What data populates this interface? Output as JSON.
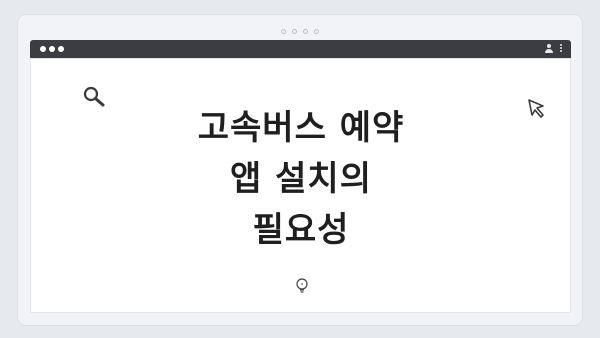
{
  "window": {
    "frame_dots": 4,
    "window_controls": [
      "close",
      "minimize",
      "maximize"
    ]
  },
  "titlebar": {
    "icons": [
      "user-icon",
      "kebab-menu-icon"
    ]
  },
  "content": {
    "headline_lines": [
      "고속버스 예약",
      "앱 설치의",
      "필요성"
    ],
    "icons": [
      "search-icon",
      "cursor-icon",
      "lightbulb-icon"
    ]
  },
  "colors": {
    "page_background": "#e6e9ee",
    "titlebar": "#3b3d42",
    "content_background": "#ffffff",
    "text": "#1f1f1f"
  }
}
